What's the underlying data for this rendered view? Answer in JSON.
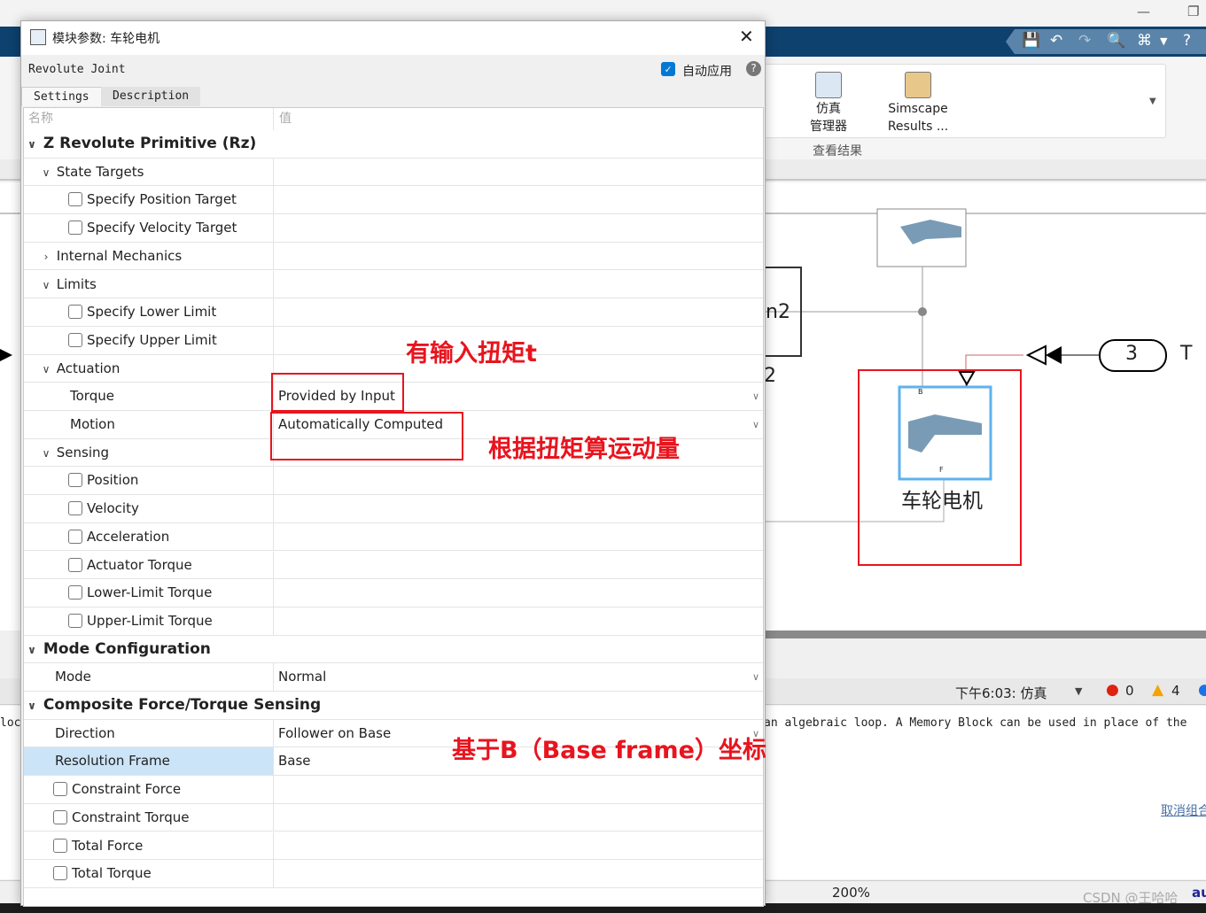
{
  "dialog": {
    "title": "模块参数: 车轮电机",
    "block_type": "Revolute Joint",
    "auto_apply": "自动应用",
    "auto_apply_checked": true,
    "tabs": [
      "Settings",
      "Description"
    ],
    "col_name": "名称",
    "col_value": "值",
    "rows": [
      {
        "t": "sec",
        "lvl": 0,
        "label": "Z Revolute Primitive (Rz)",
        "open": true
      },
      {
        "t": "grp",
        "lvl": 1,
        "label": "State Targets",
        "open": true
      },
      {
        "t": "cb",
        "lvl": 2,
        "label": "Specify Position Target"
      },
      {
        "t": "cb",
        "lvl": 2,
        "label": "Specify Velocity Target"
      },
      {
        "t": "grp",
        "lvl": 1,
        "label": "Internal Mechanics",
        "open": false
      },
      {
        "t": "grp",
        "lvl": 1,
        "label": "Limits",
        "open": true
      },
      {
        "t": "cb",
        "lvl": 2,
        "label": "Specify Lower Limit"
      },
      {
        "t": "cb",
        "lvl": 2,
        "label": "Specify Upper Limit"
      },
      {
        "t": "grp",
        "lvl": 1,
        "label": "Actuation",
        "open": true
      },
      {
        "t": "dd",
        "lvl": 2,
        "label": "Torque",
        "value": "Provided by Input"
      },
      {
        "t": "dd",
        "lvl": 2,
        "label": "Motion",
        "value": "Automatically Computed"
      },
      {
        "t": "grp",
        "lvl": 1,
        "label": "Sensing",
        "open": true
      },
      {
        "t": "cb",
        "lvl": 2,
        "label": "Position"
      },
      {
        "t": "cb",
        "lvl": 2,
        "label": "Velocity"
      },
      {
        "t": "cb",
        "lvl": 2,
        "label": "Acceleration"
      },
      {
        "t": "cb",
        "lvl": 2,
        "label": "Actuator Torque"
      },
      {
        "t": "cb",
        "lvl": 2,
        "label": "Lower-Limit Torque"
      },
      {
        "t": "cb",
        "lvl": 2,
        "label": "Upper-Limit Torque"
      },
      {
        "t": "sec",
        "lvl": 0,
        "label": "Mode Configuration",
        "open": true
      },
      {
        "t": "dd",
        "lvl": 1,
        "label": "Mode",
        "value": "Normal"
      },
      {
        "t": "sec",
        "lvl": 0,
        "label": "Composite Force/Torque Sensing",
        "open": true
      },
      {
        "t": "dd",
        "lvl": 1,
        "label": "Direction",
        "value": "Follower on Base"
      },
      {
        "t": "val",
        "lvl": 1,
        "label": "Resolution Frame",
        "value": "Base",
        "selected": true
      },
      {
        "t": "cb",
        "lvl": 1,
        "label": "Constraint Force"
      },
      {
        "t": "cb",
        "lvl": 1,
        "label": "Constraint Torque"
      },
      {
        "t": "cb",
        "lvl": 1,
        "label": "Total Force"
      },
      {
        "t": "cb",
        "lvl": 1,
        "label": "Total Torque"
      }
    ]
  },
  "annotations": {
    "torque": "有输入扭矩t",
    "motion": "根据扭矩算运动量",
    "frame": "基于B（Base frame）坐标",
    "color": "#e8141e"
  },
  "ribbon": {
    "btn1": [
      "仿真",
      "管理器"
    ],
    "btn2": [
      "Simscape",
      "Results ..."
    ],
    "group": "查看结果"
  },
  "diagram": {
    "block_label": "车轮电机",
    "partial_label": "n2",
    "partial_label2": "2",
    "inport_number": "3",
    "inport_label": "T",
    "port_b": "B",
    "port_f": "F"
  },
  "status": {
    "time": "下午6:03: 仿真",
    "errors": "0",
    "warnings": "4",
    "message": "an algebraic loop. A Memory Block can be used in place of the",
    "link": "取消组合",
    "left_msg": "loc",
    "zoom": "200%",
    "watermark": "CSDN @王哈哈",
    "extra": "au"
  },
  "colors": {
    "titlebar": "#0e416e",
    "accent": "#0078d4",
    "selection": "#cce4f7"
  }
}
